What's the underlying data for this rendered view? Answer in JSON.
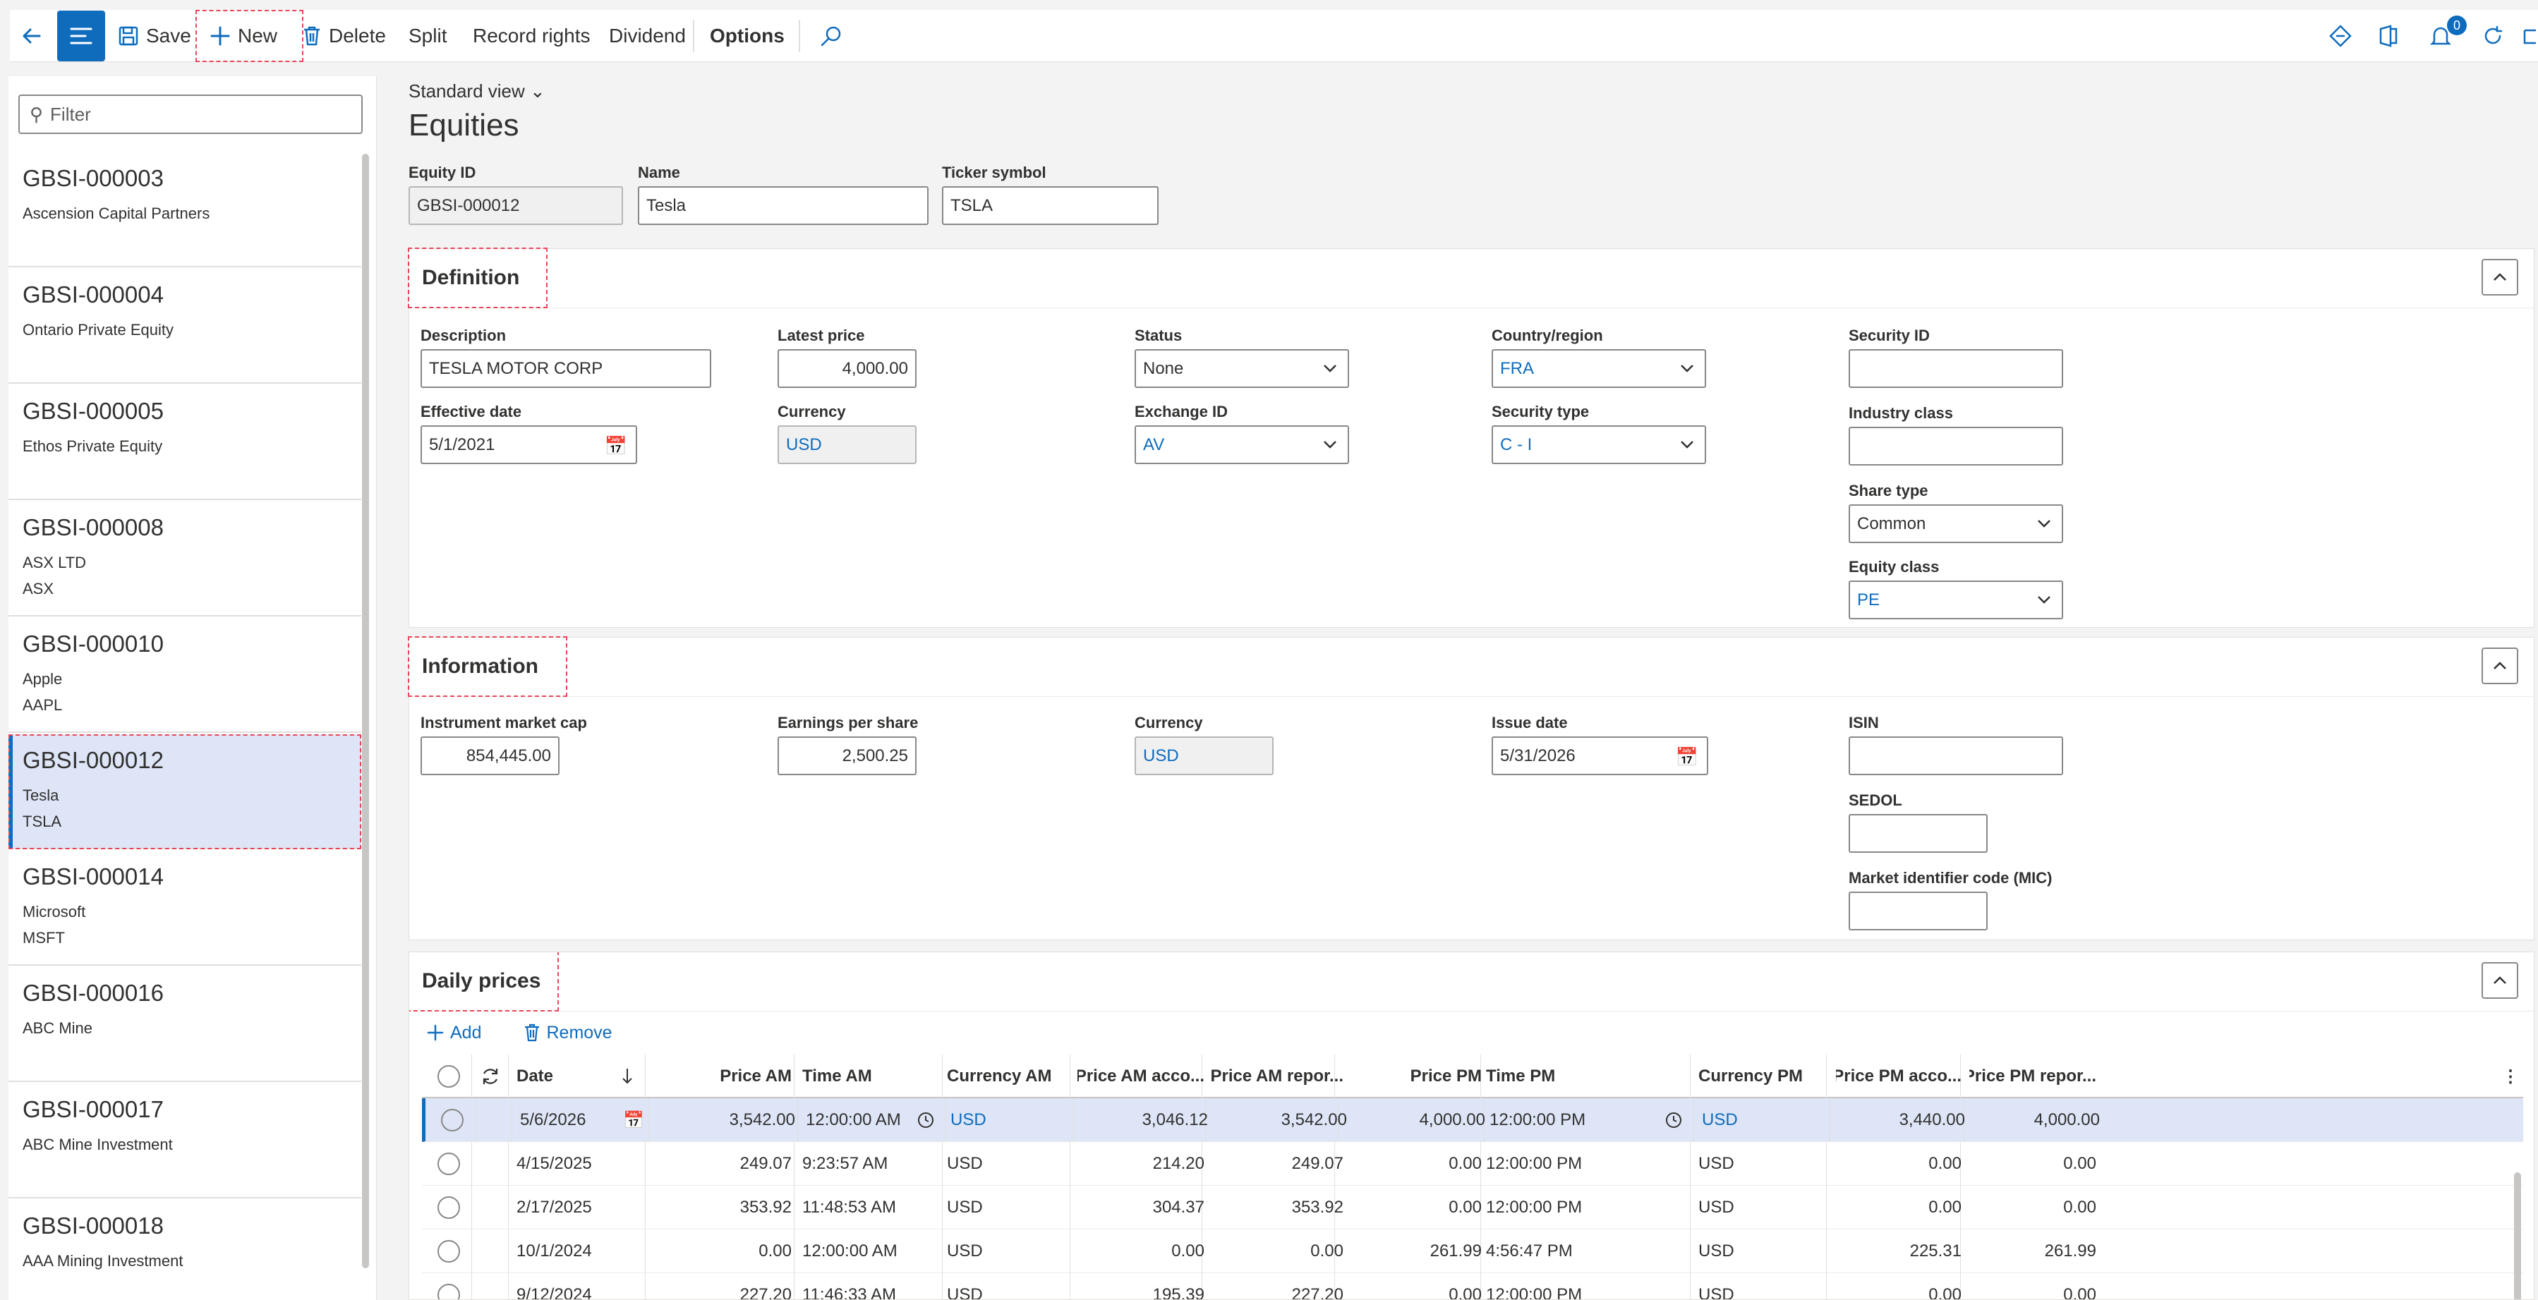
{
  "toolbar": {
    "save": "Save",
    "new": "New",
    "delete": "Delete",
    "split": "Split",
    "record_rights": "Record rights",
    "dividend": "Dividend",
    "options": "Options",
    "notification_count": "0"
  },
  "filter": {
    "placeholder": "Filter"
  },
  "list": [
    {
      "id": "GBSI-000003",
      "lines": [
        "Ascension Capital Partners"
      ]
    },
    {
      "id": "GBSI-000004",
      "lines": [
        "Ontario Private Equity"
      ]
    },
    {
      "id": "GBSI-000005",
      "lines": [
        "Ethos Private Equity"
      ]
    },
    {
      "id": "GBSI-000008",
      "lines": [
        "ASX LTD",
        "ASX"
      ]
    },
    {
      "id": "GBSI-000010",
      "lines": [
        "Apple",
        "AAPL"
      ]
    },
    {
      "id": "GBSI-000012",
      "lines": [
        "Tesla",
        "TSLA"
      ],
      "selected": true
    },
    {
      "id": "GBSI-000014",
      "lines": [
        "Microsoft",
        "MSFT"
      ]
    },
    {
      "id": "GBSI-000016",
      "lines": [
        "ABC Mine"
      ]
    },
    {
      "id": "GBSI-000017",
      "lines": [
        "ABC Mine Investment"
      ]
    },
    {
      "id": "GBSI-000018",
      "lines": [
        "AAA Mining Investment"
      ]
    }
  ],
  "view": "Standard view",
  "title": "Equities",
  "header": {
    "equity_id_label": "Equity ID",
    "equity_id": "GBSI-000012",
    "name_label": "Name",
    "name": "Tesla",
    "ticker_label": "Ticker symbol",
    "ticker": "TSLA"
  },
  "definition": {
    "title": "Definition",
    "description_label": "Description",
    "description": "TESLA MOTOR CORP",
    "effective_date_label": "Effective date",
    "effective_date": "5/1/2021",
    "latest_price_label": "Latest price",
    "latest_price": "4,000.00",
    "currency_label": "Currency",
    "currency": "USD",
    "status_label": "Status",
    "status": "None",
    "exchange_label": "Exchange ID",
    "exchange": "AV",
    "country_label": "Country/region",
    "country": "FRA",
    "security_type_label": "Security type",
    "security_type": "C - I",
    "security_id_label": "Security ID",
    "security_id": "",
    "industry_label": "Industry class",
    "industry": "",
    "share_type_label": "Share type",
    "share_type": "Common",
    "equity_class_label": "Equity class",
    "equity_class": "PE"
  },
  "information": {
    "title": "Information",
    "market_cap_label": "Instrument market cap",
    "market_cap": "854,445.00",
    "eps_label": "Earnings per share",
    "eps": "2,500.25",
    "currency_label": "Currency",
    "currency": "USD",
    "issue_date_label": "Issue date",
    "issue_date": "5/31/2026",
    "isin_label": "ISIN",
    "isin": "",
    "sedol_label": "SEDOL",
    "sedol": "",
    "mic_label": "Market identifier code (MIC)",
    "mic": ""
  },
  "daily": {
    "title": "Daily prices",
    "add": "Add",
    "remove": "Remove",
    "columns": [
      "Date",
      "Price AM",
      "Time AM",
      "Currency AM",
      "Price AM acco...",
      "Price AM repor...",
      "Price PM",
      "Time PM",
      "Currency PM",
      "Price PM acco...",
      "Price PM repor..."
    ],
    "rows": [
      [
        "5/6/2026",
        "3,542.00",
        "12:00:00 AM",
        "USD",
        "3,046.12",
        "3,542.00",
        "4,000.00",
        "12:00:00 PM",
        "USD",
        "3,440.00",
        "4,000.00"
      ],
      [
        "4/15/2025",
        "249.07",
        "9:23:57 AM",
        "USD",
        "214.20",
        "249.07",
        "0.00",
        "12:00:00 PM",
        "USD",
        "0.00",
        "0.00"
      ],
      [
        "2/17/2025",
        "353.92",
        "11:48:53 AM",
        "USD",
        "304.37",
        "353.92",
        "0.00",
        "12:00:00 PM",
        "USD",
        "0.00",
        "0.00"
      ],
      [
        "10/1/2024",
        "0.00",
        "12:00:00 AM",
        "USD",
        "0.00",
        "0.00",
        "261.99",
        "4:56:47 PM",
        "USD",
        "225.31",
        "261.99"
      ],
      [
        "9/12/2024",
        "227.20",
        "11:46:33 AM",
        "USD",
        "195.39",
        "227.20",
        "0.00",
        "12:00:00 PM",
        "USD",
        "0.00",
        "0.00"
      ]
    ]
  },
  "colors": {
    "accent": "#0f6cbd",
    "selected_bg": "#dde5f7",
    "highlight_outline": "#e8465a"
  }
}
